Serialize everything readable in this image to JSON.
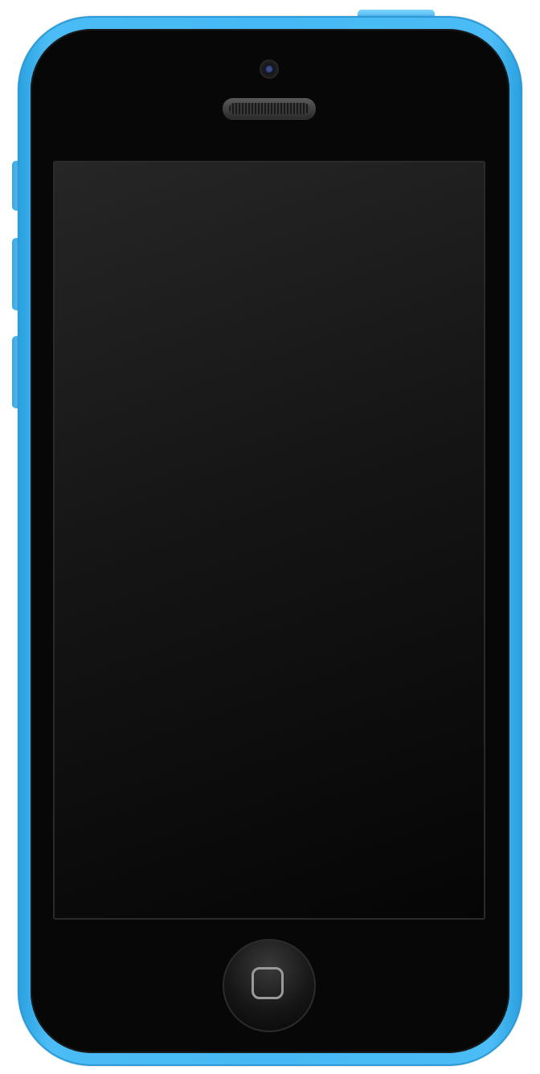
{
  "device": {
    "model_family": "smartphone",
    "colors": {
      "body": "#46b8f3",
      "face": "#070707",
      "screen_top": "#262626",
      "screen_bottom": "#050505",
      "home_ring": "#9a9a9a"
    },
    "icons": {
      "camera": "camera-icon",
      "speaker": "speaker-grille-icon",
      "home": "home-square-icon"
    }
  }
}
